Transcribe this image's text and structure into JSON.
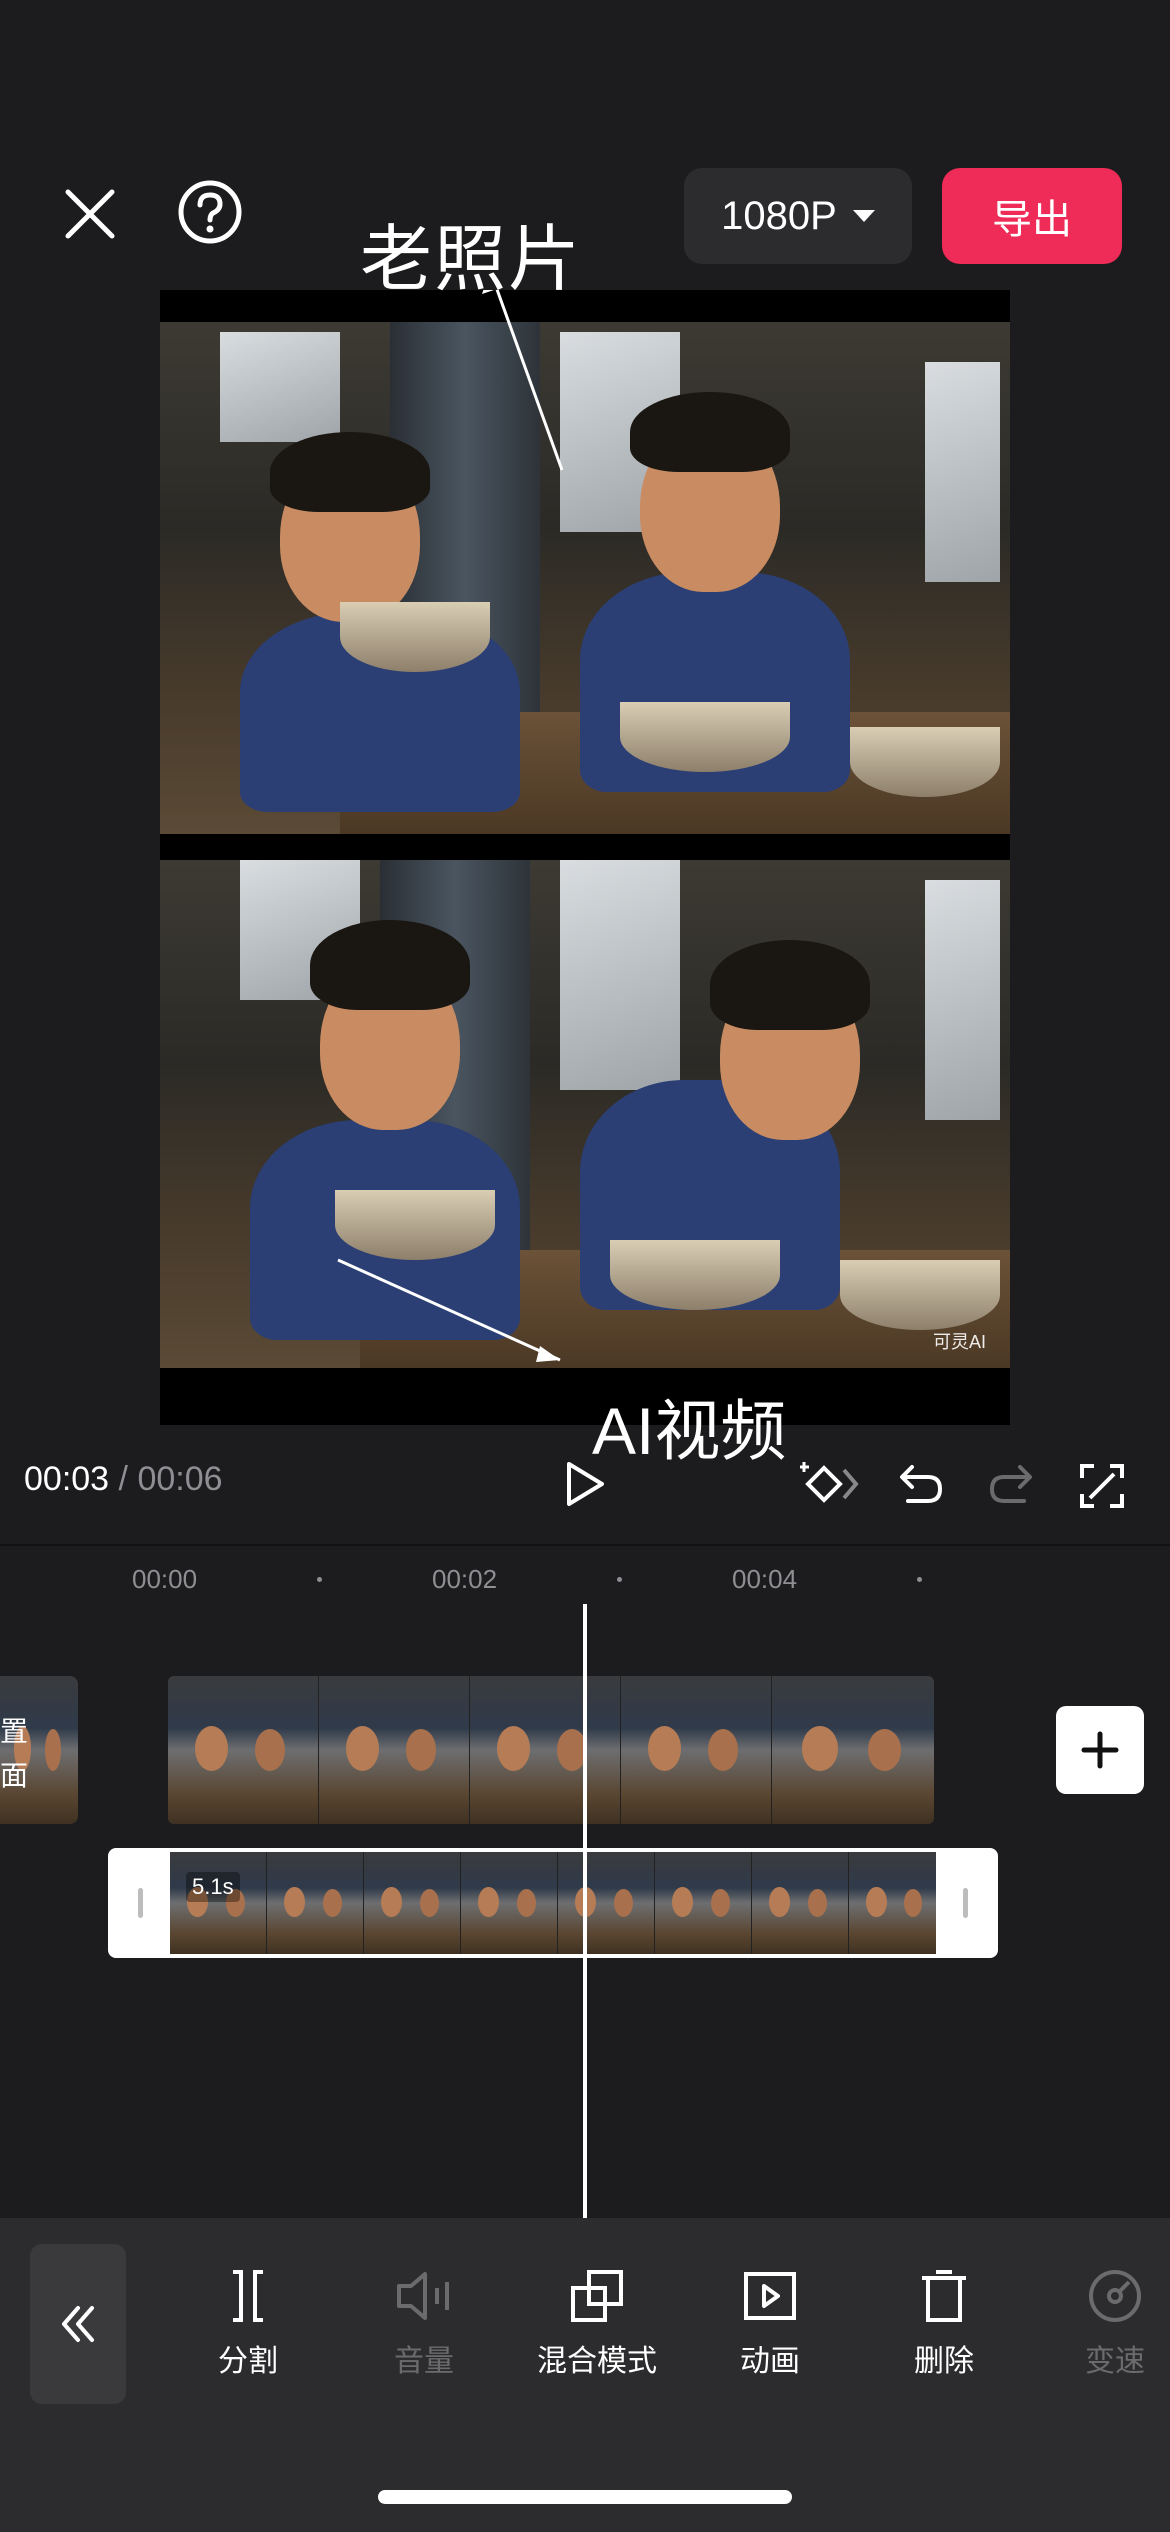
{
  "header": {
    "close_icon": "close-icon",
    "help_icon": "help-icon",
    "resolution_label": "1080P",
    "export_label": "导出"
  },
  "preview": {
    "overlay_top_text": "老照片",
    "overlay_bottom_text": "AI视频",
    "watermark": "可灵AI"
  },
  "playback": {
    "current_time": "00:03",
    "separator": "/",
    "total_time": "00:06"
  },
  "timeline": {
    "ruler": [
      "00:00",
      "00:02",
      "00:04"
    ],
    "prev_clip_text": [
      "置",
      "面"
    ],
    "selected_clip_duration": "5.1s"
  },
  "toolbar": {
    "items": [
      {
        "label": "分割",
        "icon": "split-icon",
        "enabled": true
      },
      {
        "label": "音量",
        "icon": "volume-icon",
        "enabled": false
      },
      {
        "label": "混合模式",
        "icon": "blend-mode-icon",
        "enabled": true
      },
      {
        "label": "动画",
        "icon": "animation-icon",
        "enabled": true
      },
      {
        "label": "删除",
        "icon": "delete-icon",
        "enabled": true
      },
      {
        "label": "变速",
        "icon": "speed-icon",
        "enabled": false
      }
    ]
  },
  "colors": {
    "accent": "#ee2c57",
    "background": "#1c1c1e",
    "toolbar_bg": "#2c2c2e",
    "selection_border": "#b5395a"
  }
}
